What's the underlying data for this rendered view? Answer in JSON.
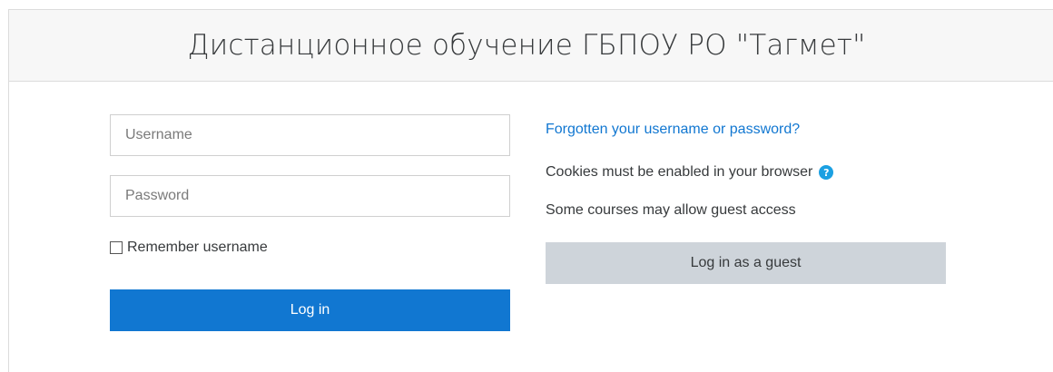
{
  "header": {
    "title": "Дистанционное обучение ГБПОУ РО \"Тагмет\""
  },
  "login_form": {
    "username_placeholder": "Username",
    "username_value": "",
    "password_placeholder": "Password",
    "password_value": "",
    "remember_label": "Remember username",
    "remember_checked": false,
    "login_button_label": "Log in"
  },
  "side_info": {
    "forgot_link": "Forgotten your username or password?",
    "cookies_text": "Cookies must be enabled in your browser",
    "help_icon": "question-circle-icon",
    "guest_note": "Some courses may allow guest access",
    "guest_button_label": "Log in as a guest"
  },
  "colors": {
    "primary": "#1177d1",
    "secondary_button": "#ced4da",
    "help_icon": "#1ba0e2",
    "header_background": "#f7f7f7"
  }
}
